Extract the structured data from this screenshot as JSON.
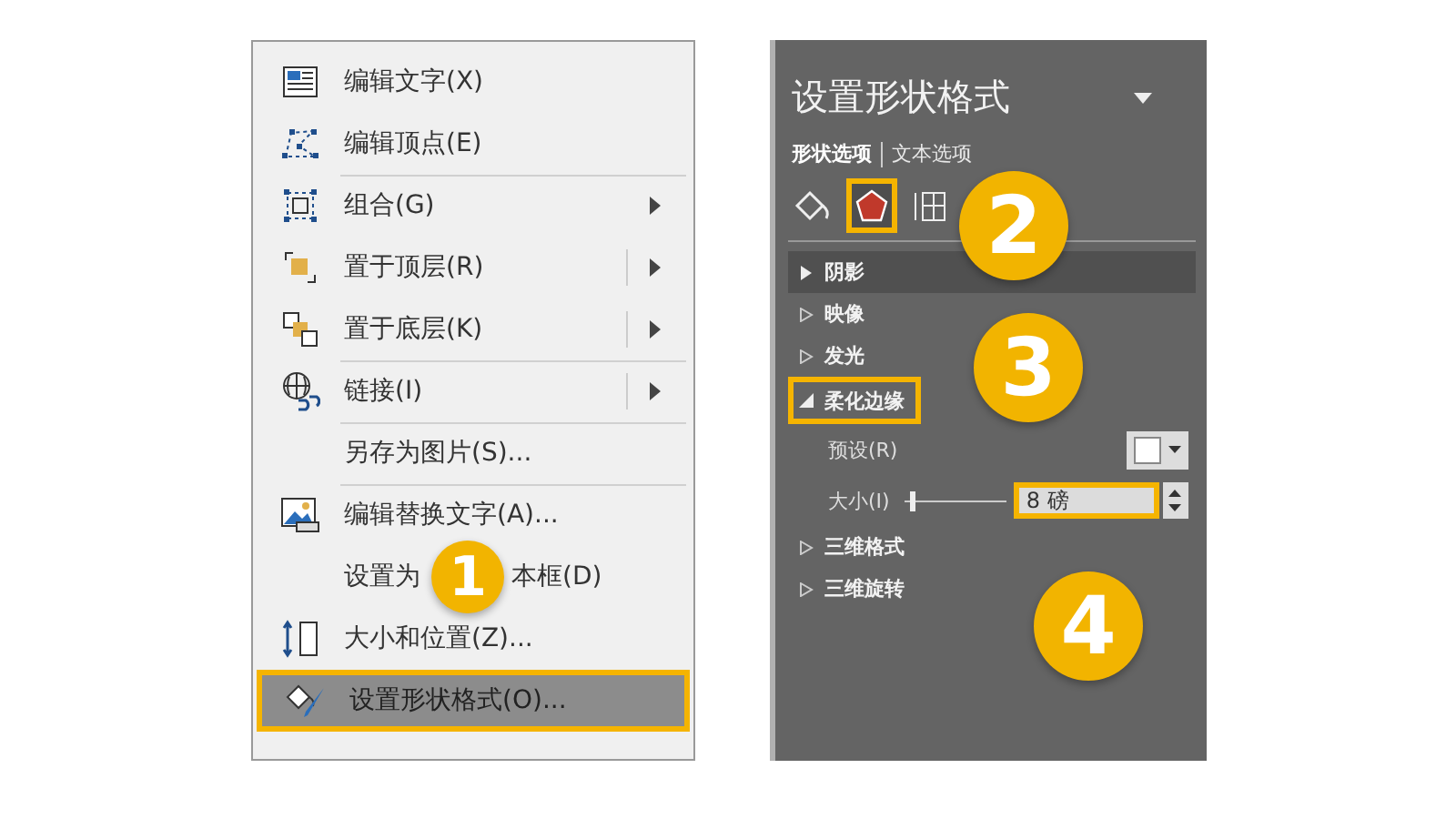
{
  "menu": {
    "items": [
      {
        "label": "编辑文字(X)",
        "submenu": false,
        "split": false,
        "separator_before": false,
        "highlighted": false
      },
      {
        "label": "编辑顶点(E)",
        "submenu": false,
        "split": false,
        "separator_before": false,
        "highlighted": false
      },
      {
        "label": "组合(G)",
        "submenu": true,
        "split": false,
        "separator_before": true,
        "highlighted": false
      },
      {
        "label": "置于顶层(R)",
        "submenu": true,
        "split": true,
        "separator_before": false,
        "highlighted": false
      },
      {
        "label": "置于底层(K)",
        "submenu": true,
        "split": true,
        "separator_before": false,
        "highlighted": false
      },
      {
        "label": "链接(I)",
        "submenu": true,
        "split": true,
        "separator_before": true,
        "highlighted": false
      },
      {
        "label": "另存为图片(S)...",
        "submenu": false,
        "split": false,
        "separator_before": true,
        "highlighted": false
      },
      {
        "label": "编辑替换文字(A)...",
        "submenu": false,
        "split": false,
        "separator_before": true,
        "highlighted": false
      },
      {
        "label": "设置为",
        "label_after": "本框(D)",
        "highlighted": false
      },
      {
        "label": "大小和位置(Z)...",
        "submenu": false,
        "split": false,
        "separator_before": false,
        "highlighted": false
      },
      {
        "label": "设置形状格式(O)...",
        "submenu": false,
        "split": false,
        "separator_before": false,
        "highlighted": true
      }
    ]
  },
  "pane": {
    "title": "设置形状格式",
    "tabs": [
      {
        "label": "形状选项",
        "selected": true
      },
      {
        "label": "文本选项",
        "selected": false
      }
    ],
    "icon_tabs": [
      {
        "selected": false,
        "highlighted": false
      },
      {
        "selected": true,
        "highlighted": true
      },
      {
        "selected": false,
        "highlighted": false
      }
    ],
    "sections": [
      {
        "label": "阴影",
        "expanded": false,
        "hovered": true,
        "highlighted": false
      },
      {
        "label": "映像",
        "expanded": false,
        "hovered": false,
        "highlighted": false
      },
      {
        "label": "发光",
        "expanded": false,
        "hovered": false,
        "highlighted": false
      },
      {
        "label": "柔化边缘",
        "expanded": true,
        "hovered": false,
        "highlighted": true,
        "fields": [
          {
            "kind": "preset",
            "label": "预设(R)"
          },
          {
            "kind": "size",
            "label": "大小(I)",
            "level": 0.05,
            "value": "8 磅",
            "highlighted": true
          }
        ]
      },
      {
        "label": "三维格式",
        "expanded": false,
        "hovered": false,
        "highlighted": false
      },
      {
        "label": "三维旋转",
        "expanded": false,
        "hovered": false,
        "highlighted": false
      }
    ]
  },
  "callouts": [
    {
      "text": "1"
    },
    {
      "text": "2"
    },
    {
      "text": "3"
    },
    {
      "text": "4"
    }
  ]
}
